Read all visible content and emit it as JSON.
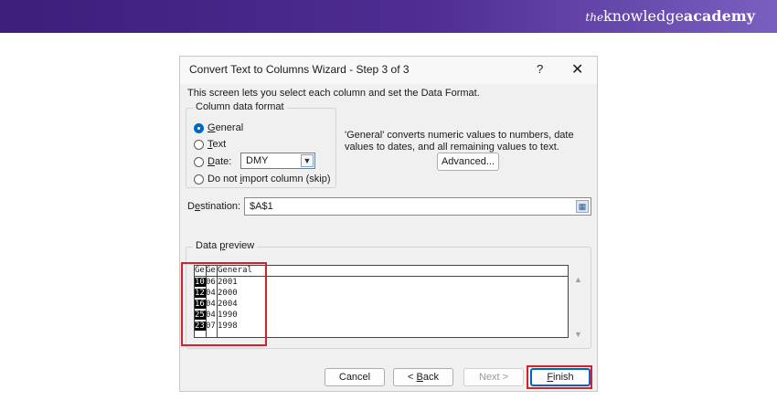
{
  "banner": {
    "brand_prefix": "the",
    "brand_main": "knowledge",
    "brand_bold": "academy"
  },
  "dialog": {
    "title": "Convert Text to Columns Wizard - Step 3 of 3",
    "help": "?",
    "close": "✕",
    "description": "This screen lets you select each column and set the Data Format.",
    "format_group_label": "Column data format",
    "options": [
      {
        "label": "General",
        "checked": true
      },
      {
        "label": "Text",
        "checked": false
      },
      {
        "label": "Date:",
        "checked": false
      },
      {
        "label": "Do not import column (skip)",
        "checked": false
      }
    ],
    "date_format": "DMY",
    "info_text": "'General' converts numeric values to numbers, date values to dates, and all remaining values to text.",
    "advanced_label": "Advanced...",
    "destination_label": "Destination:",
    "destination_value": "$A$1",
    "preview_label": "Data preview",
    "preview": {
      "headers": [
        "Ge",
        "Ge",
        "General"
      ],
      "rows": [
        [
          "10",
          "06",
          "2001"
        ],
        [
          "12",
          "04",
          "2000"
        ],
        [
          "16",
          "04",
          "2004"
        ],
        [
          "25",
          "04",
          "1990"
        ],
        [
          "23",
          "07",
          "1998"
        ]
      ]
    },
    "buttons": {
      "cancel": "Cancel",
      "back": "< Back",
      "next": "Next >",
      "finish": "Finish"
    }
  },
  "colors": {
    "highlight": "#d9202a",
    "accent": "#0067c0",
    "banner": "#4f2d93"
  }
}
